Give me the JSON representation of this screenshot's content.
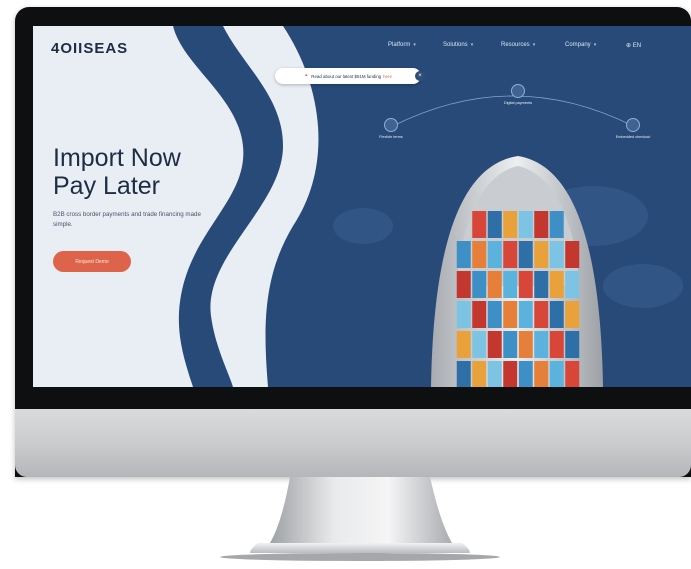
{
  "site": {
    "logo_text": "4OIISEAS",
    "nav": [
      {
        "label": "Platform"
      },
      {
        "label": "Solutions"
      },
      {
        "label": "Resources"
      },
      {
        "label": "Company"
      }
    ],
    "language": "EN"
  },
  "banner": {
    "text": "Read about our latest $51M funding",
    "link_text": "here"
  },
  "hero": {
    "title_line1": "Import Now",
    "title_line2": "Pay Later",
    "subtitle": "B2B cross border payments and trade financing made simple.",
    "cta_label": "Request Demo"
  },
  "features": [
    {
      "label": "Digital payments",
      "icon": "payment-icon"
    },
    {
      "label": "Flexible terms",
      "icon": "calendar-icon"
    },
    {
      "label": "Embedded checkout",
      "icon": "checkout-icon"
    }
  ],
  "colors": {
    "navy": "#274a78",
    "light_bg": "#e8eef4",
    "accent": "#dd644a",
    "text_dark": "#1d2d44"
  }
}
